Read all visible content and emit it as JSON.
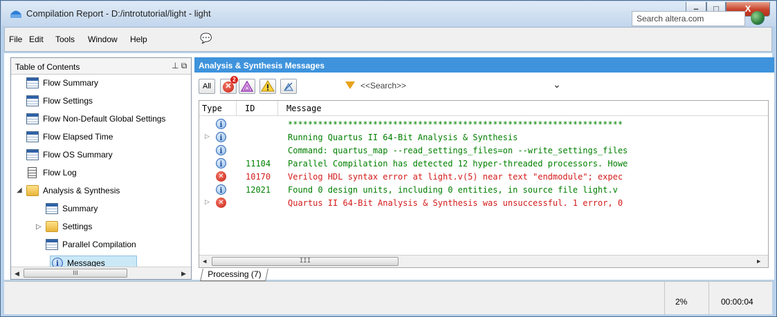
{
  "window": {
    "title": "Compilation Report - D:/introtutorial/light - light",
    "minimize_label": "–",
    "maximize_label": "□",
    "close_label": "X"
  },
  "menu": {
    "items": [
      "File",
      "Edit",
      "Tools",
      "Window",
      "Help"
    ],
    "extra_icon": "chat-icon",
    "search_placeholder": "Search altera.com"
  },
  "toc": {
    "title": "Table of Contents",
    "pin_label": "ᚹ ᖷ",
    "items": [
      {
        "label": "Flow Summary",
        "icon": "table-icon"
      },
      {
        "label": "Flow Settings",
        "icon": "table-icon"
      },
      {
        "label": "Flow Non-Default Global Settings",
        "icon": "table-icon"
      },
      {
        "label": "Flow Elapsed Time",
        "icon": "table-icon"
      },
      {
        "label": "Flow OS Summary",
        "icon": "table-icon"
      },
      {
        "label": "Flow Log",
        "icon": "log-icon"
      },
      {
        "label": "Analysis & Synthesis",
        "icon": "folder-icon"
      },
      {
        "label": "Summary",
        "icon": "table-icon"
      },
      {
        "label": "Settings",
        "icon": "folder-icon"
      },
      {
        "label": "Parallel Compilation",
        "icon": "table-icon"
      },
      {
        "label": "Messages",
        "icon": "info-icon"
      }
    ],
    "scroll_grip": "III"
  },
  "messages_panel": {
    "title": "Analysis & Synthesis Messages",
    "all_label": "All",
    "error_count": "2",
    "search_placeholder": "<<Search>>",
    "columns": [
      "Type",
      "ID",
      "Message"
    ],
    "rows": [
      {
        "type": "info",
        "id": "",
        "message": "*******************************************************************",
        "color": "#008000",
        "expandable": false
      },
      {
        "type": "info",
        "id": "",
        "message": "Running Quartus II 64-Bit Analysis & Synthesis",
        "color": "#008000",
        "expandable": true
      },
      {
        "type": "info",
        "id": "",
        "message": "Command: quartus_map --read_settings_files=on --write_settings_files",
        "color": "#008000",
        "expandable": false
      },
      {
        "type": "info",
        "id": "11104",
        "message": "Parallel Compilation has detected 12 hyper-threaded processors. Howe",
        "color": "#008000",
        "expandable": false
      },
      {
        "type": "error",
        "id": "10170",
        "message": "Verilog HDL syntax error at light.v(5) near text \"endmodule\";  expec",
        "color": "#d41a1a",
        "expandable": false
      },
      {
        "type": "info",
        "id": "12021",
        "message": "Found 0 design units, including 0 entities, in source file light.v",
        "color": "#008000",
        "expandable": false
      },
      {
        "type": "error",
        "id": "",
        "message": "Quartus II 64-Bit Analysis & Synthesis was unsuccessful. 1 error, 0",
        "color": "#d41a1a",
        "expandable": true
      }
    ],
    "scroll_grip": "III",
    "tab_label": "Processing (7)"
  },
  "status": {
    "progress": "2%",
    "elapsed": "00:00:04"
  }
}
